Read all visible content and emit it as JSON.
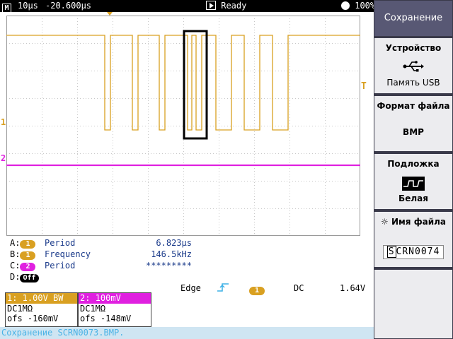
{
  "topbar": {
    "mode_icon": "M",
    "timebase": "10µs",
    "delay": "-20.600µs",
    "run_state": "Ready",
    "battery": "100%"
  },
  "channels": {
    "ch1": {
      "marker": "1",
      "color": "#d9a021",
      "scale": "1: 1.00V",
      "bw": "BW",
      "coupling": "DC1MΩ",
      "offset_label": "ofs",
      "offset": "-160mV"
    },
    "ch2": {
      "marker": "2",
      "color": "#e020e0",
      "scale": "2: 100mV",
      "coupling": "DC1MΩ",
      "offset_label": "ofs",
      "offset": "-148mV"
    }
  },
  "measurements": [
    {
      "slot": "A:",
      "channel": "1",
      "name": "Period",
      "value": "6.823µs"
    },
    {
      "slot": "B:",
      "channel": "1",
      "name": "Frequency",
      "value": "146.5kHz"
    },
    {
      "slot": "C:",
      "channel": "2",
      "name": "Period",
      "value": "*********"
    },
    {
      "slot": "D:",
      "channel": "Off",
      "name": "",
      "value": ""
    }
  ],
  "trigger": {
    "type": "Edge",
    "source": "1",
    "coupling": "DC",
    "level": "1.64V"
  },
  "status_line": "Сохранение SCRN0073.BMP.",
  "menu": {
    "title": "Сохранение",
    "device": {
      "label": "Устройство",
      "value": "Память USB",
      "icon": "usb-icon"
    },
    "format": {
      "label": "Формат файла",
      "value": "BMP"
    },
    "background": {
      "label": "Подложка",
      "value": "Белая",
      "icon": "waveform-icon"
    },
    "filename": {
      "label": "Имя файла",
      "cursor_char": "S",
      "rest": "CRN0074",
      "icon": "gear-icon"
    }
  }
}
